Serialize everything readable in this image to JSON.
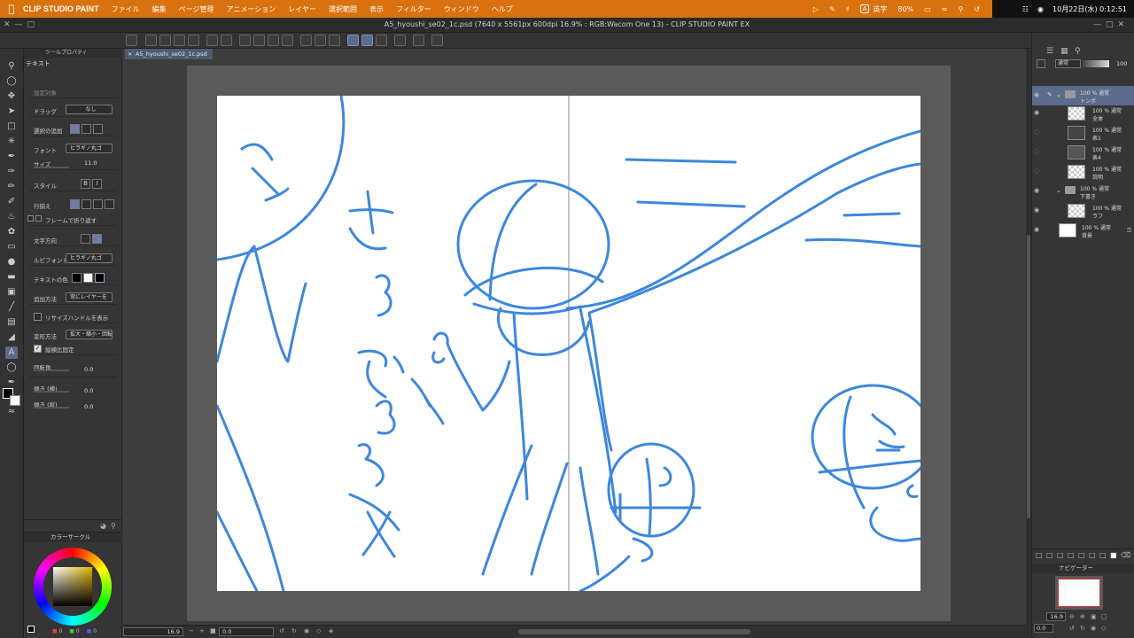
{
  "menubar": {
    "app_name": "CLIP STUDIO PAINT",
    "menus": [
      "ファイル",
      "編集",
      "ページ管理",
      "アニメーション",
      "レイヤー",
      "選択範囲",
      "表示",
      "フィルター",
      "ウィンドウ",
      "ヘルプ"
    ],
    "ime_mode": "A",
    "ime_label": "英字",
    "battery": "80%",
    "datetime": "10月22日(水) 0:12:51"
  },
  "window": {
    "title": "A5_hyoushi_se02_1c.psd (7640 x 5561px 600dpi 16.9% : RGB:Wacom One 13)  - CLIP STUDIO PAINT EX"
  },
  "document_tab": {
    "label": "A5_hyoushi_se02_1c.psd"
  },
  "tool_property": {
    "header": "ツールプロパティ",
    "tool_name": "テキスト",
    "rows": {
      "settings_target": {
        "label": "設定対象"
      },
      "drag": {
        "label": "ドラッグ",
        "value": "なし"
      },
      "add_selection": {
        "label": "選択の追加"
      },
      "font": {
        "label": "フォント",
        "value": "ヒラギノ丸ゴ"
      },
      "size": {
        "label": "サイズ",
        "value": "11.0"
      },
      "style": {
        "label": "スタイル",
        "bold": "B",
        "italic": "I"
      },
      "align": {
        "label": "行揃え"
      },
      "frame_wrap": {
        "label": "フレームで折り返す"
      },
      "direction": {
        "label": "文字方向"
      },
      "ruby_font": {
        "label": "ルビフォント",
        "value": "ヒラギノ丸ゴ"
      },
      "text_color": {
        "label": "テキストの色"
      },
      "add_method": {
        "label": "追加方法",
        "value": "常にレイヤーを"
      },
      "resize_handle": {
        "label": "リサイズハンドルを表示"
      },
      "transform": {
        "label": "変形方法",
        "value": "拡大・縮小・回転"
      },
      "keep_ratio": {
        "label": "縦横比固定"
      },
      "rotation": {
        "label": "回転角",
        "value": "0.0"
      },
      "skew_h": {
        "label": "傾き (横)",
        "value": "0.0"
      },
      "skew_v": {
        "label": "傾き (縦)",
        "value": "0.0"
      }
    }
  },
  "color_panel": {
    "header": "カラーサークル",
    "r": "0",
    "g": "0",
    "b": "0"
  },
  "status": {
    "zoom": "16.9",
    "rotation": "0.0"
  },
  "layers": {
    "blend_mode": "通常",
    "opacity": "100",
    "items": [
      {
        "line1": "100 % 通常",
        "line2": "トンボ",
        "type": "folder",
        "selected": true
      },
      {
        "line1": "100 % 通常",
        "line2": "全体",
        "type": "raster"
      },
      {
        "line1": "100 % 通常",
        "line2": "表1",
        "type": "raster"
      },
      {
        "line1": "100 % 通常",
        "line2": "表4",
        "type": "raster"
      },
      {
        "line1": "100 % 通常",
        "line2": "説明",
        "type": "raster"
      },
      {
        "line1": "100 % 通常",
        "line2": "下書き",
        "type": "folder"
      },
      {
        "line1": "100 % 通常",
        "line2": "ラフ",
        "type": "raster"
      },
      {
        "line1": "100 % 通常",
        "line2": "背景",
        "type": "paper"
      }
    ]
  },
  "navigator": {
    "header": "ナビゲーター",
    "zoom": "16.9",
    "rotation": "0.0"
  },
  "colors": {
    "accent_orange": "#d9720e",
    "selection_blue": "#5a6b8c",
    "sketch_stroke": "#3d87dc"
  }
}
